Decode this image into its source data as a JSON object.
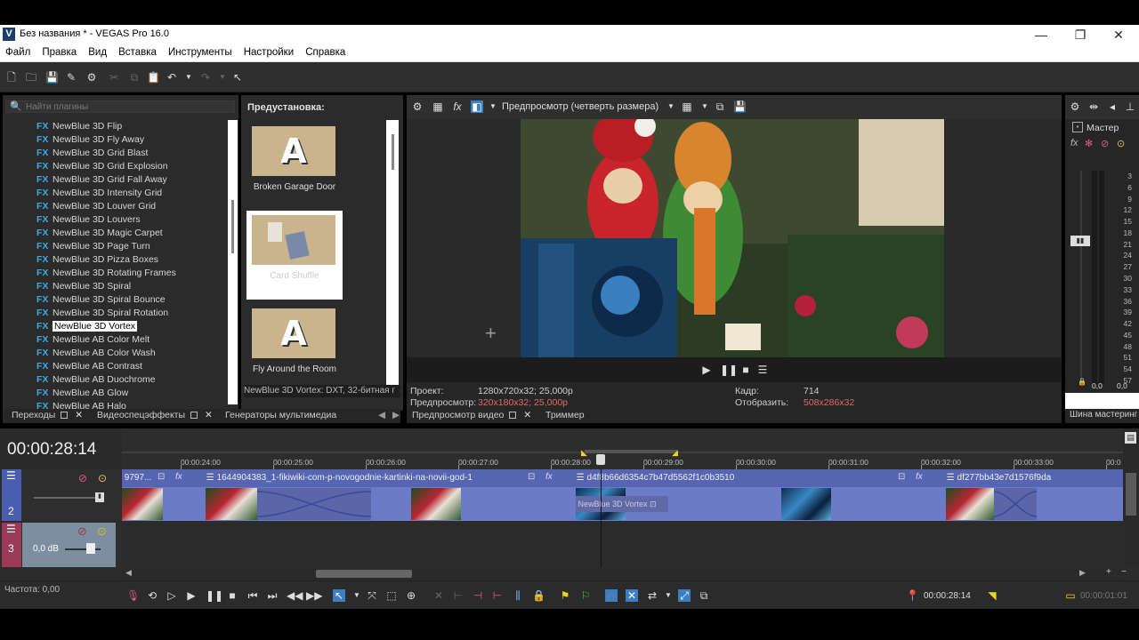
{
  "window": {
    "title": "Без названия * - VEGAS Pro 16.0",
    "logo": "V",
    "controls": [
      "—",
      "❐",
      "✕"
    ]
  },
  "menu": [
    "Файл",
    "Правка",
    "Вид",
    "Вставка",
    "Инструменты",
    "Настройки",
    "Справка"
  ],
  "plugins": {
    "search_placeholder": "Найти плагины",
    "items": [
      "NewBlue 3D Flip",
      "NewBlue 3D Fly Away",
      "NewBlue 3D Grid Blast",
      "NewBlue 3D Grid Explosion",
      "NewBlue 3D Grid Fall Away",
      "NewBlue 3D Intensity Grid",
      "NewBlue 3D Louver Grid",
      "NewBlue 3D Louvers",
      "NewBlue 3D Magic Carpet",
      "NewBlue 3D Page Turn",
      "NewBlue 3D Pizza Boxes",
      "NewBlue 3D Rotating Frames",
      "NewBlue 3D Spiral",
      "NewBlue 3D Spiral Bounce",
      "NewBlue 3D Spiral Rotation",
      "NewBlue 3D Vortex",
      "NewBlue AB Color Melt",
      "NewBlue AB Color Wash",
      "NewBlue AB Contrast",
      "NewBlue AB Duochrome",
      "NewBlue AB Glow",
      "NewBlue AB Halo"
    ],
    "selected_index": 15,
    "fx_badge": "FX"
  },
  "presets": {
    "heading": "Предустановка:",
    "items": [
      {
        "label": "Broken Garage Door",
        "glyph": "A"
      },
      {
        "label": "Card Shuffle",
        "glyph": ""
      },
      {
        "label": "Fly Around the Room",
        "glyph": "A"
      }
    ],
    "status": "NewBlue 3D Vortex: DXT, 32-битная г"
  },
  "left_tabs": {
    "t1": "Переходы",
    "t2": "Видеоспецэффекты",
    "t3": "Генераторы мультимедиа"
  },
  "preview": {
    "mode": "Предпросмотр (четверть размера)",
    "project_label": "Проект:",
    "project_value": "1280x720x32; 25,000p",
    "preview_label": "Предпросмотр:",
    "preview_value": "320x180x32; 25,000p",
    "frame_label": "Кадр:",
    "frame_value": "714",
    "display_label": "Отобразить:",
    "display_value": "508x286x32",
    "tab1": "Предпросмотр видео",
    "tab2": "Триммер"
  },
  "master": {
    "label": "Мастер",
    "ticks": [
      "3",
      "6",
      "9",
      "12",
      "15",
      "18",
      "21",
      "24",
      "27",
      "30",
      "33",
      "36",
      "39",
      "42",
      "45",
      "48",
      "51",
      "54",
      "57"
    ],
    "left_value": "0,0",
    "right_value": "0,0",
    "tab": "Шина мастеринг"
  },
  "timeline": {
    "timecode": "00:00:28:14",
    "ruler": [
      "00:00:24:00",
      "00:00:25:00",
      "00:00:26:00",
      "00:00:27:00",
      "00:00:28:00",
      "00:00:29:00",
      "00:00:30:00",
      "00:00:31:00",
      "00:00:32:00",
      "00:00:33:00",
      "00:0"
    ],
    "track1_num": "2",
    "track2_num": "3",
    "track2_volume": "0,0 dB",
    "events": [
      {
        "title": "9797..."
      },
      {
        "title": "1644904383_1-fikiwiki-com-p-novogodnie-kartinki-na-novii-god-1"
      },
      {
        "title": "d4f8b66d6354c7b47d5562f1c0b3510"
      },
      {
        "title": "df277bb43e7d1576f9da"
      }
    ],
    "fx_label": "NewBlue 3D Vortex",
    "rate_label": "Частота: 0,00"
  },
  "bottom": {
    "cursor_time": "00:00:28:14",
    "duration": "00:00:01:01"
  },
  "colors": {
    "track_video": "#6b7bc7",
    "track_audio_num": "#9a3a58",
    "accent": "#3fa8e0"
  }
}
